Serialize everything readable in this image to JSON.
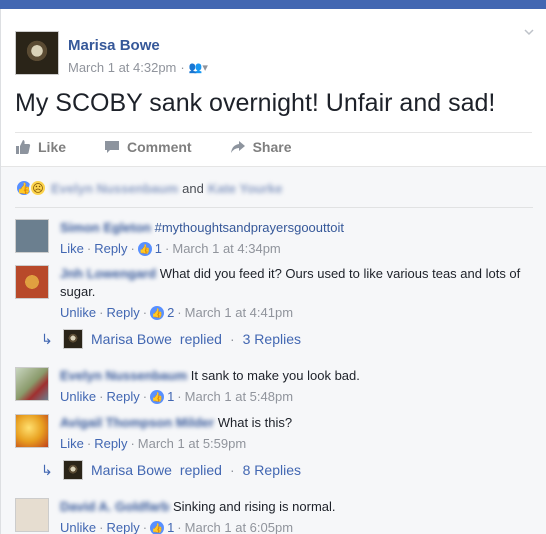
{
  "post": {
    "author": "Marisa Bowe",
    "timestamp": "March 1 at 4:32pm",
    "audience_icon": "friends-icon",
    "text": "My SCOBY sank overnight! Unfair and sad!",
    "actions": {
      "like": "Like",
      "comment": "Comment",
      "share": "Share"
    }
  },
  "reactions": {
    "names": [
      "Evelyn Nussenbaum",
      "Kate Yourke"
    ],
    "joiner": "and"
  },
  "comments": [
    {
      "author": "Simon Egleton",
      "text": "#mythoughtsandprayersgoouttoit",
      "like_label": "Like",
      "reply_label": "Reply",
      "likes": "1",
      "timestamp": "March 1 at 4:34pm",
      "avatar_color": "#6b7f8f"
    },
    {
      "author": "Jnh Lowengard",
      "text": "What did you feed it? Ours used to like various teas and lots of sugar.",
      "like_label": "Unlike",
      "reply_label": "Reply",
      "likes": "2",
      "timestamp": "March 1 at 4:41pm",
      "avatar_color": "#b8492a",
      "replies": {
        "author": "Marisa Bowe",
        "replied": "replied",
        "count": "3 Replies"
      }
    },
    {
      "author": "Evelyn Nussenbaum",
      "text": "It sank to make you look bad.",
      "like_label": "Unlike",
      "reply_label": "Reply",
      "likes": "1",
      "timestamp": "March 1 at 5:48pm",
      "avatar_color": "#8a9a6b"
    },
    {
      "author": "Avigail Thompson Milder",
      "text": "What is this?",
      "like_label": "Like",
      "reply_label": "Reply",
      "timestamp": "March 1 at 5:59pm",
      "avatar_color": "#e8a020",
      "replies": {
        "author": "Marisa Bowe",
        "replied": "replied",
        "count": "8 Replies"
      }
    },
    {
      "author": "David A. Goldfarb",
      "text": "Sinking and rising is normal.",
      "like_label": "Unlike",
      "reply_label": "Reply",
      "likes": "1",
      "timestamp": "March 1 at 6:05pm",
      "avatar_color": "#d8cfc2"
    }
  ]
}
